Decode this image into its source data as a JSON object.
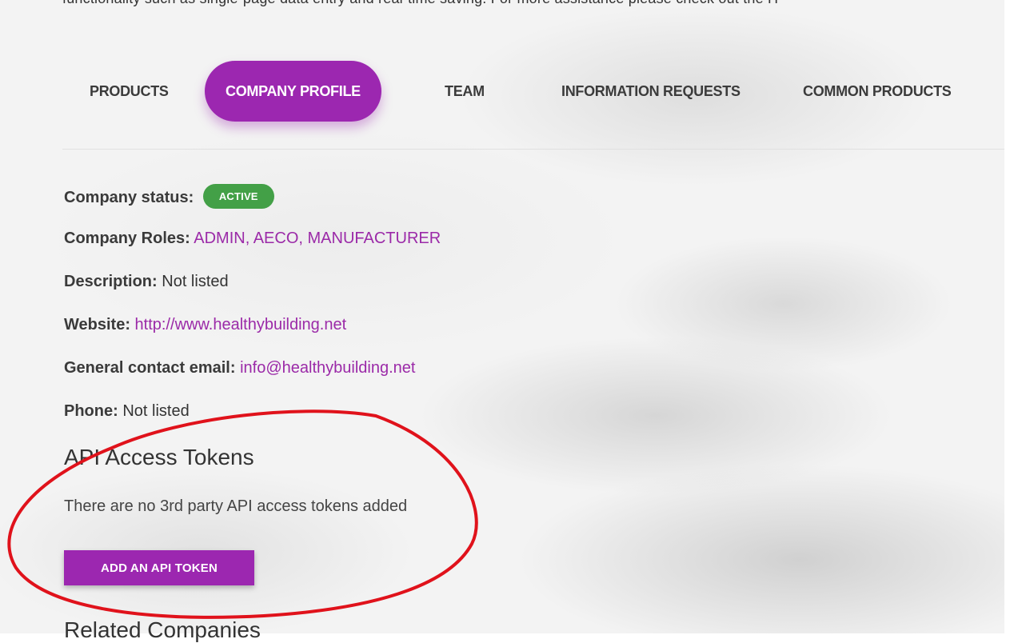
{
  "top_text": "functionality such as single-page data entry and real-time saving. For more assistance please check out the H",
  "tabs": [
    {
      "label": "PRODUCTS",
      "active": false
    },
    {
      "label": "COMPANY PROFILE",
      "active": true
    },
    {
      "label": "TEAM",
      "active": false
    },
    {
      "label": "INFORMATION REQUESTS",
      "active": false
    },
    {
      "label": "COMMON PRODUCTS",
      "active": false
    }
  ],
  "company": {
    "status_label": "Company status:",
    "status_value": "ACTIVE",
    "roles_label": "Company Roles:",
    "roles_value": "ADMIN, AECO, MANUFACTURER",
    "description_label": "Description:",
    "description_value": "Not listed",
    "website_label": "Website:",
    "website_value": "http://www.healthybuilding.net",
    "email_label": "General contact email:",
    "email_value": "info@healthybuilding.net",
    "phone_label": "Phone:",
    "phone_value": "Not listed"
  },
  "api": {
    "heading": "API Access Tokens",
    "empty_message": "There are no 3rd party API access tokens added",
    "add_button": "ADD AN API TOKEN"
  },
  "related_heading": "Related Companies",
  "colors": {
    "accent": "#9c27b0",
    "link": "#9b2aa8",
    "status_badge": "#43a047",
    "annotation": "#e0121b"
  }
}
